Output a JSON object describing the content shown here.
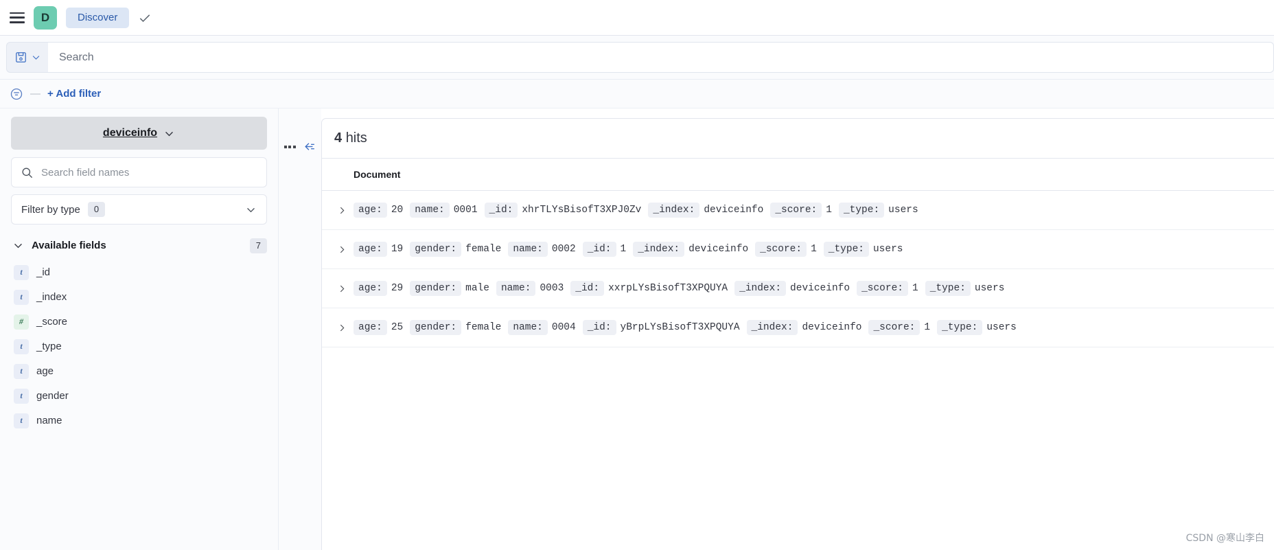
{
  "topnav": {
    "menu_icon": "hamburger-menu-icon",
    "app_badge": "D",
    "app_name": "Discover",
    "check_icon": "check-icon"
  },
  "query_bar": {
    "saved_query_icon": "save-disk-icon",
    "dropdown_icon": "chevron-down-icon",
    "search_placeholder": "Search",
    "search_value": ""
  },
  "filter_bar": {
    "filter_icon": "filter-list-icon",
    "dash": "—",
    "add_filter_label": "+ Add filter"
  },
  "sidebar": {
    "index_pattern": "deviceinfo",
    "index_pattern_chevron": "chevron-down-icon",
    "field_search_placeholder": "Search field names",
    "field_search_value": "",
    "search_icon": "search-icon",
    "filter_by_type_label": "Filter by type",
    "filter_by_type_count": "0",
    "available_fields_label": "Available fields",
    "available_fields_count": "7",
    "fields": [
      {
        "name": "_id",
        "type": "string",
        "glyph": "t"
      },
      {
        "name": "_index",
        "type": "string",
        "glyph": "t"
      },
      {
        "name": "_score",
        "type": "number",
        "glyph": "#"
      },
      {
        "name": "_type",
        "type": "string",
        "glyph": "t"
      },
      {
        "name": "age",
        "type": "string",
        "glyph": "t"
      },
      {
        "name": "gender",
        "type": "string",
        "glyph": "t"
      },
      {
        "name": "name",
        "type": "string",
        "glyph": "t"
      }
    ]
  },
  "tools": {
    "more_icon": "more-options-dots-icon",
    "collapse_icon": "collapse-sidebar-icon"
  },
  "results": {
    "hits_count": "4",
    "hits_label": "hits",
    "column_header": "Document",
    "expand_icon": "chevron-right-icon",
    "rows": [
      {
        "fields": [
          {
            "key": "age:",
            "value": "20"
          },
          {
            "key": "name:",
            "value": "0001"
          },
          {
            "key": "_id:",
            "value": "xhrTLYsBisofT3XPJ0Zv"
          },
          {
            "key": "_index:",
            "value": "deviceinfo"
          },
          {
            "key": "_score:",
            "value": "1"
          },
          {
            "key": "_type:",
            "value": "users"
          }
        ]
      },
      {
        "fields": [
          {
            "key": "age:",
            "value": "19"
          },
          {
            "key": "gender:",
            "value": "female"
          },
          {
            "key": "name:",
            "value": "0002"
          },
          {
            "key": "_id:",
            "value": "1"
          },
          {
            "key": "_index:",
            "value": "deviceinfo"
          },
          {
            "key": "_score:",
            "value": "1"
          },
          {
            "key": "_type:",
            "value": "users"
          }
        ]
      },
      {
        "fields": [
          {
            "key": "age:",
            "value": "29"
          },
          {
            "key": "gender:",
            "value": "male"
          },
          {
            "key": "name:",
            "value": "0003"
          },
          {
            "key": "_id:",
            "value": "xxrpLYsBisofT3XPQUYA"
          },
          {
            "key": "_index:",
            "value": "deviceinfo"
          },
          {
            "key": "_score:",
            "value": "1"
          },
          {
            "key": "_type:",
            "value": "users"
          }
        ]
      },
      {
        "fields": [
          {
            "key": "age:",
            "value": "25"
          },
          {
            "key": "gender:",
            "value": "female"
          },
          {
            "key": "name:",
            "value": "0004"
          },
          {
            "key": "_id:",
            "value": "yBrpLYsBisofT3XPQUYA"
          },
          {
            "key": "_index:",
            "value": "deviceinfo"
          },
          {
            "key": "_score:",
            "value": "1"
          },
          {
            "key": "_type:",
            "value": "users"
          }
        ]
      }
    ]
  },
  "watermark": "CSDN @寒山李白",
  "colors": {
    "accent_blue": "#2c5fb8",
    "badge_green": "#6dccb1",
    "pill_blue_bg": "#dce6f5",
    "key_chip_bg": "#eef0f5"
  }
}
